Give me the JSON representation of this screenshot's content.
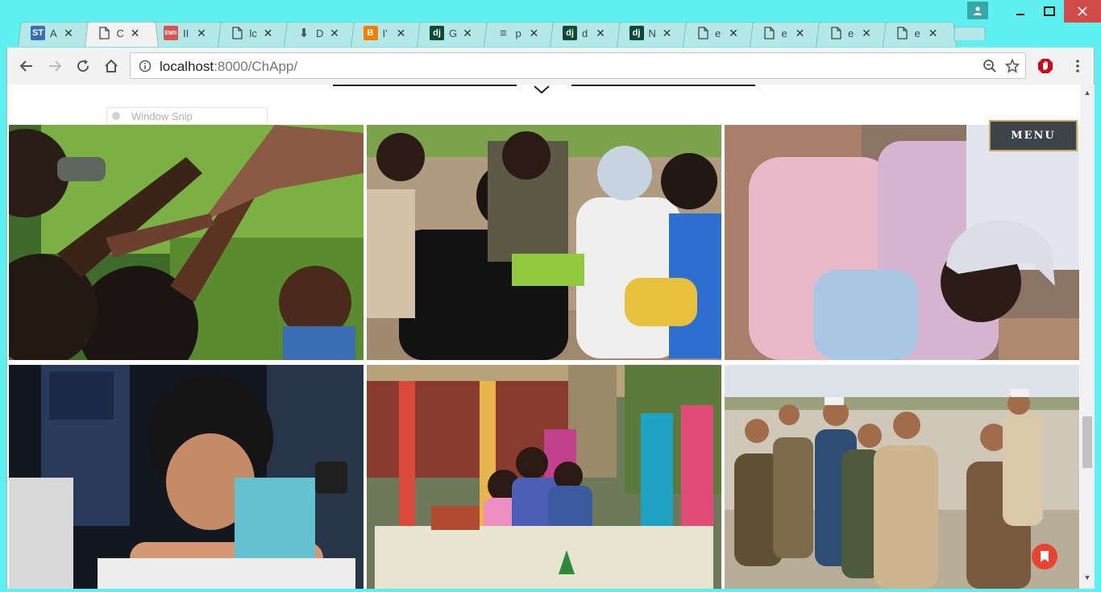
{
  "browser": {
    "tabs": [
      {
        "title": "A",
        "icon": "blue-doc-icon",
        "fav_bg": "#3a6fb7",
        "fav_text": "ST"
      },
      {
        "title": "C",
        "icon": "page-icon",
        "fav_bg": "",
        "fav_text": "",
        "active": true
      },
      {
        "title": "II",
        "icon": "ems-icon",
        "fav_bg": "#d9534f",
        "fav_text": "EMS"
      },
      {
        "title": "lc",
        "icon": "page-icon",
        "fav_bg": "",
        "fav_text": ""
      },
      {
        "title": "D",
        "icon": "download-icon",
        "fav_bg": "",
        "fav_text": "⬇"
      },
      {
        "title": "I'",
        "icon": "blogger-icon",
        "fav_bg": "#f57d00",
        "fav_text": "B"
      },
      {
        "title": "G",
        "icon": "django-icon",
        "fav_bg": "#0c4b33",
        "fav_text": "dj"
      },
      {
        "title": "p",
        "icon": "stackoverflow-icon",
        "fav_bg": "",
        "fav_text": "≡"
      },
      {
        "title": "d",
        "icon": "django-icon",
        "fav_bg": "#0c4b33",
        "fav_text": "dj"
      },
      {
        "title": "N",
        "icon": "django-icon",
        "fav_bg": "#0c4b33",
        "fav_text": "dj"
      },
      {
        "title": "e",
        "icon": "page-icon",
        "fav_bg": "",
        "fav_text": ""
      },
      {
        "title": "e",
        "icon": "page-icon",
        "fav_bg": "",
        "fav_text": ""
      },
      {
        "title": "e",
        "icon": "page-icon",
        "fav_bg": "",
        "fav_text": ""
      },
      {
        "title": "e",
        "icon": "page-icon",
        "fav_bg": "",
        "fav_text": ""
      }
    ],
    "close_glyph": "✕",
    "url_host": "localhost",
    "url_rest": ":8000/ChApp/"
  },
  "page": {
    "menu_label": "MENU",
    "snip_label": "Window Snip"
  },
  "photos": [
    {
      "name": "photo-children-hands",
      "scene": "children-hands"
    },
    {
      "name": "photo-children-sitting",
      "scene": "children-sitting"
    },
    {
      "name": "photo-child-white-cap",
      "scene": "child-cap"
    },
    {
      "name": "photo-boy-resting",
      "scene": "boy-resting"
    },
    {
      "name": "photo-girls-laughing",
      "scene": "girls-laughing"
    },
    {
      "name": "photo-boys-group",
      "scene": "boys-group"
    }
  ],
  "colors": {
    "frame": "#5ff0f0",
    "menu_bg": "#3e434a",
    "menu_border": "#c9a95f",
    "fab": "#e8432f"
  }
}
